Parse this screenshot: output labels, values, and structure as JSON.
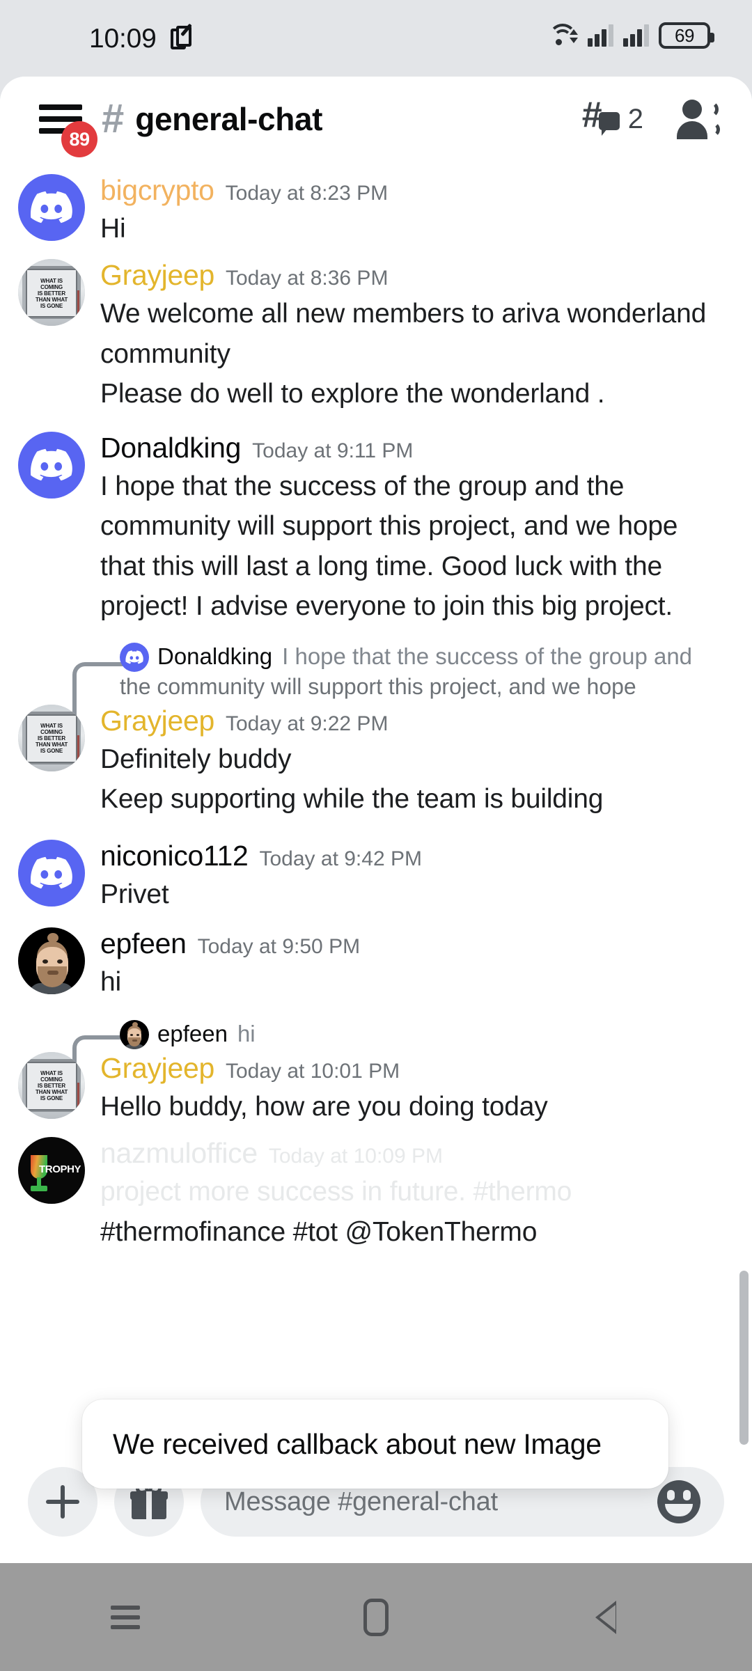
{
  "status_bar": {
    "time": "10:09",
    "note_icon": "note-edit-icon",
    "wifi_icon": "wifi-icon",
    "signal_icon": "cellular-signal-icon",
    "battery_level": "69"
  },
  "header": {
    "menu_badge": "89",
    "hash_icon": "#",
    "channel_name": "general-chat",
    "threads_count": "2",
    "members_icon": "members-icon"
  },
  "messages": [
    {
      "author": "bigcrypto",
      "author_color": "#f2b25f",
      "timestamp": "Today at 8:23 PM",
      "avatar": "discord-logo-avatar",
      "lines": [
        "Hi"
      ]
    },
    {
      "author": "Grayjeep",
      "author_color": "#e3b52c",
      "timestamp": "Today at 8:36 PM",
      "avatar": "road-sign-avatar",
      "lines": [
        "We welcome all new members to ariva wonderland",
        "community",
        "Please do well to explore the wonderland ."
      ]
    },
    {
      "author": "Donaldking",
      "author_color": "#0b0c0d",
      "timestamp": "Today at 9:11 PM",
      "avatar": "discord-logo-avatar",
      "lines": [
        "I hope that the success of the group and the",
        "community will support this project, and we hope",
        "that this will last a long time. Good luck with the",
        "project! I advise everyone to join this big project."
      ]
    },
    {
      "reply_to": {
        "author": "Donaldking",
        "avatar": "discord-logo-avatar",
        "snippet_line_1": "I hope that the success of the group and",
        "snippet_line_2": "the community will support this project, and we hope"
      },
      "author": "Grayjeep",
      "author_color": "#e3b52c",
      "timestamp": "Today at 9:22 PM",
      "avatar": "road-sign-avatar",
      "lines": [
        "Definitely buddy",
        "Keep supporting while the team is building"
      ]
    },
    {
      "author": "niconico112",
      "author_color": "#0b0c0d",
      "timestamp": "Today at 9:42 PM",
      "avatar": "discord-logo-avatar",
      "lines": [
        "Privet"
      ]
    },
    {
      "author": "epfeen",
      "author_color": "#0b0c0d",
      "timestamp": "Today at 9:50 PM",
      "avatar": "memoji-avatar",
      "lines": [
        "hi"
      ]
    },
    {
      "reply_to": {
        "author": "epfeen",
        "avatar": "memoji-avatar",
        "snippet_line_1": "hi",
        "snippet_line_2": ""
      },
      "author": "Grayjeep",
      "author_color": "#e3b52c",
      "timestamp": "Today at 10:01 PM",
      "avatar": "road-sign-avatar",
      "lines": [
        "Hello buddy, how are you doing today"
      ]
    },
    {
      "author": "nazmuloffice",
      "author_color": "#0b0c0d",
      "timestamp": "Today at 10:09 PM",
      "avatar": "trophy-avatar",
      "obscured": true,
      "lines": [
        "project more success in future. #thermo",
        "#thermofinance #tot @TokenThermo"
      ]
    }
  ],
  "road_sign_avatar_text": [
    "WHAT IS",
    "COMING",
    "IS BETTER",
    "THAN WHAT",
    "IS GONE"
  ],
  "trophy_avatar_text": "TROPHY",
  "toast": {
    "message": "We received callback about new Image"
  },
  "composer": {
    "add_icon": "plus-icon",
    "gift_icon": "gift-icon",
    "placeholder": "Message #general-chat",
    "emoji_icon": "emoji-icon"
  },
  "nav_bar": {
    "recents_icon": "recents-icon",
    "home_icon": "home-icon",
    "back_icon": "back-icon"
  }
}
